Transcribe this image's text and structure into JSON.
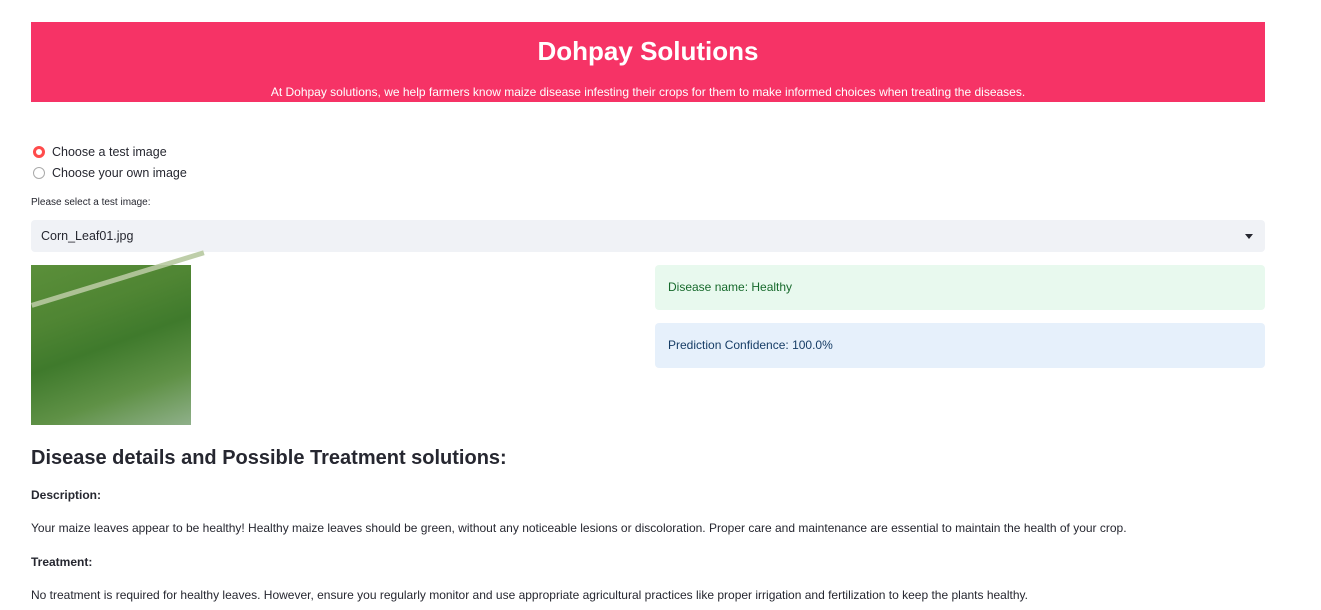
{
  "header": {
    "title": "Dohpay Solutions",
    "subtitle": "At Dohpay solutions, we help farmers know maize disease infesting their crops for them to make informed choices when treating the diseases."
  },
  "radio": {
    "options": [
      {
        "label": "Choose a test image",
        "selected": true
      },
      {
        "label": "Choose your own image",
        "selected": false
      }
    ]
  },
  "select": {
    "label": "Please select a test image:",
    "value": "Corn_Leaf01.jpg"
  },
  "results": {
    "disease": "Disease name: Healthy",
    "confidence": "Prediction Confidence: 100.0%"
  },
  "details": {
    "heading": "Disease details and Possible Treatment solutions:",
    "description_label": "Description:",
    "description": "Your maize leaves appear to be healthy! Healthy maize leaves should be green, without any noticeable lesions or discoloration. Proper care and maintenance are essential to maintain the health of your crop.",
    "treatment_label": "Treatment:",
    "treatment": "No treatment is required for healthy leaves. However, ensure you regularly monitor and use appropriate agricultural practices like proper irrigation and fertilization to keep the plants healthy."
  },
  "colors": {
    "brand": "#f63366",
    "accent": "#ff4b4b"
  }
}
